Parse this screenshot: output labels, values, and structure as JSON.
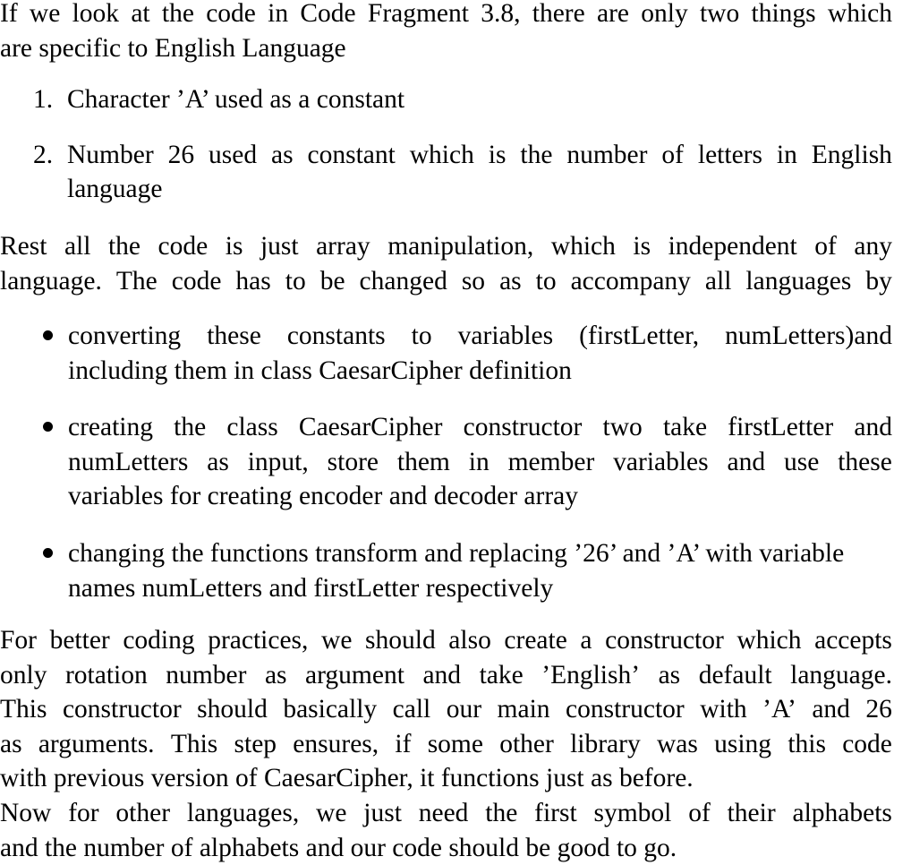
{
  "document": {
    "intro_paragraph": {
      "lines": [
        {
          "words": [
            "If",
            "we",
            "look",
            "at",
            "the",
            "code",
            "in",
            "Code",
            "Fragment",
            "3.8,",
            "there",
            "are",
            "only",
            "two",
            "things",
            "which"
          ],
          "justified": true
        },
        {
          "text": "are specific to English Language",
          "justified": false
        }
      ],
      "full_text": "If we look at the code in Code Fragment 3.8, there are only two things which are specific to English Language"
    },
    "numbered_list": {
      "items": [
        {
          "marker": "1.",
          "lines": [
            {
              "text": "Character ’A’ used as a constant",
              "justified": false
            }
          ],
          "full_text": "Character ’A’ used as a constant"
        },
        {
          "marker": "2.",
          "lines": [
            {
              "words": [
                "Number",
                "26",
                "used",
                "as",
                "constant",
                "which",
                "is",
                "the",
                "number",
                "of",
                "letters",
                "in",
                "English"
              ],
              "justified": true
            },
            {
              "text": "language",
              "justified": false
            }
          ],
          "full_text": "Number 26 used as constant which is the number of letters in English language"
        }
      ]
    },
    "rest_paragraph": {
      "lines": [
        {
          "words": [
            "Rest",
            "all",
            "the",
            "code",
            "is",
            "just",
            "array",
            "manipulation,",
            "which",
            "is",
            "independent",
            "of",
            "any"
          ],
          "justified": true
        },
        {
          "words": [
            "language.",
            "The",
            "code",
            "has",
            "to",
            "be",
            "changed",
            "so",
            "as",
            "to",
            "accompany",
            "all",
            "languages",
            "by"
          ],
          "justified": true
        }
      ],
      "full_text": "Rest all the code is just array manipulation, which is independent of any language. The code has to be changed so as to accompany all languages by"
    },
    "bulleted_list": {
      "bullet_glyph": "•",
      "items": [
        {
          "lines": [
            {
              "words": [
                "converting",
                "these",
                "constants",
                "to",
                "variables",
                "(firstLetter,",
                "numLetters)and"
              ],
              "justified": true
            },
            {
              "text": "including them in class CaesarCipher definition",
              "justified": false
            }
          ],
          "full_text": "converting these constants to variables (firstLetter, numLetters)and including them in class CaesarCipher definition"
        },
        {
          "lines": [
            {
              "words": [
                "creating",
                "the",
                "class",
                "CaesarCipher",
                "constructor",
                "two",
                "take",
                "firstLetter",
                "and"
              ],
              "justified": true
            },
            {
              "words": [
                "numLetters",
                "as",
                "input,",
                "store",
                "them",
                "in",
                "member",
                "variables",
                "and",
                "use",
                "these"
              ],
              "justified": true
            },
            {
              "text": "variables for creating encoder and decoder array",
              "justified": false
            }
          ],
          "full_text": "creating the class CaesarCipher constructor two take firstLetter and numLetters as input, store them in member variables and use these variables for creating encoder and decoder array"
        },
        {
          "lines": [
            {
              "text": "changing the functions transform and replacing ’26’ and ’A’ with variable",
              "justified": false
            },
            {
              "text": "names numLetters and firstLetter respectively",
              "justified": false
            }
          ],
          "full_text": "changing the functions transform and replacing ’26’ and ’A’ with variable names numLetters and firstLetter respectively"
        }
      ]
    },
    "closing_paragraph": {
      "lines": [
        {
          "words": [
            "For",
            "better",
            "coding",
            "practices,",
            "we",
            "should",
            "also",
            "create",
            "a",
            "constructor",
            "which",
            "accepts"
          ],
          "justified": true
        },
        {
          "words": [
            "only",
            "rotation",
            "number",
            "as",
            "argument",
            "and",
            "take",
            "’English’",
            "as",
            "default",
            "language."
          ],
          "justified": true
        },
        {
          "words": [
            "This",
            "constructor",
            "should",
            "basically",
            "call",
            "our",
            "main",
            "constructor",
            "with",
            "’A’",
            "and",
            "26"
          ],
          "justified": true
        },
        {
          "words": [
            "as",
            "arguments.",
            "This",
            "step",
            "ensures,",
            "if",
            "some",
            "other",
            "library",
            "was",
            "using",
            "this",
            "code"
          ],
          "justified": true
        },
        {
          "text": "with previous version of CaesarCipher, it functions just as before.",
          "justified": false
        },
        {
          "words": [
            "Now",
            "for",
            "other",
            "languages,",
            "we",
            "just",
            "need",
            "the",
            "first",
            "symbol",
            "of",
            "their",
            "alphabets"
          ],
          "justified": true
        },
        {
          "text": "and the number of alphabets and our code should be good to go.",
          "justified": false
        }
      ],
      "full_text": "For better coding practices, we should also create a constructor which accepts only rotation number as argument and take ’English’ as default language. This constructor should basically call our main constructor with ’A’ and 26 as arguments. This step ensures, if some other library was using this code with previous version of CaesarCipher, it functions just as before. Now for other languages, we just need the first symbol of their alphabets and the number of alphabets and our code should be good to go."
    }
  },
  "colors": {
    "text": "#000000",
    "background": "#ffffff"
  }
}
